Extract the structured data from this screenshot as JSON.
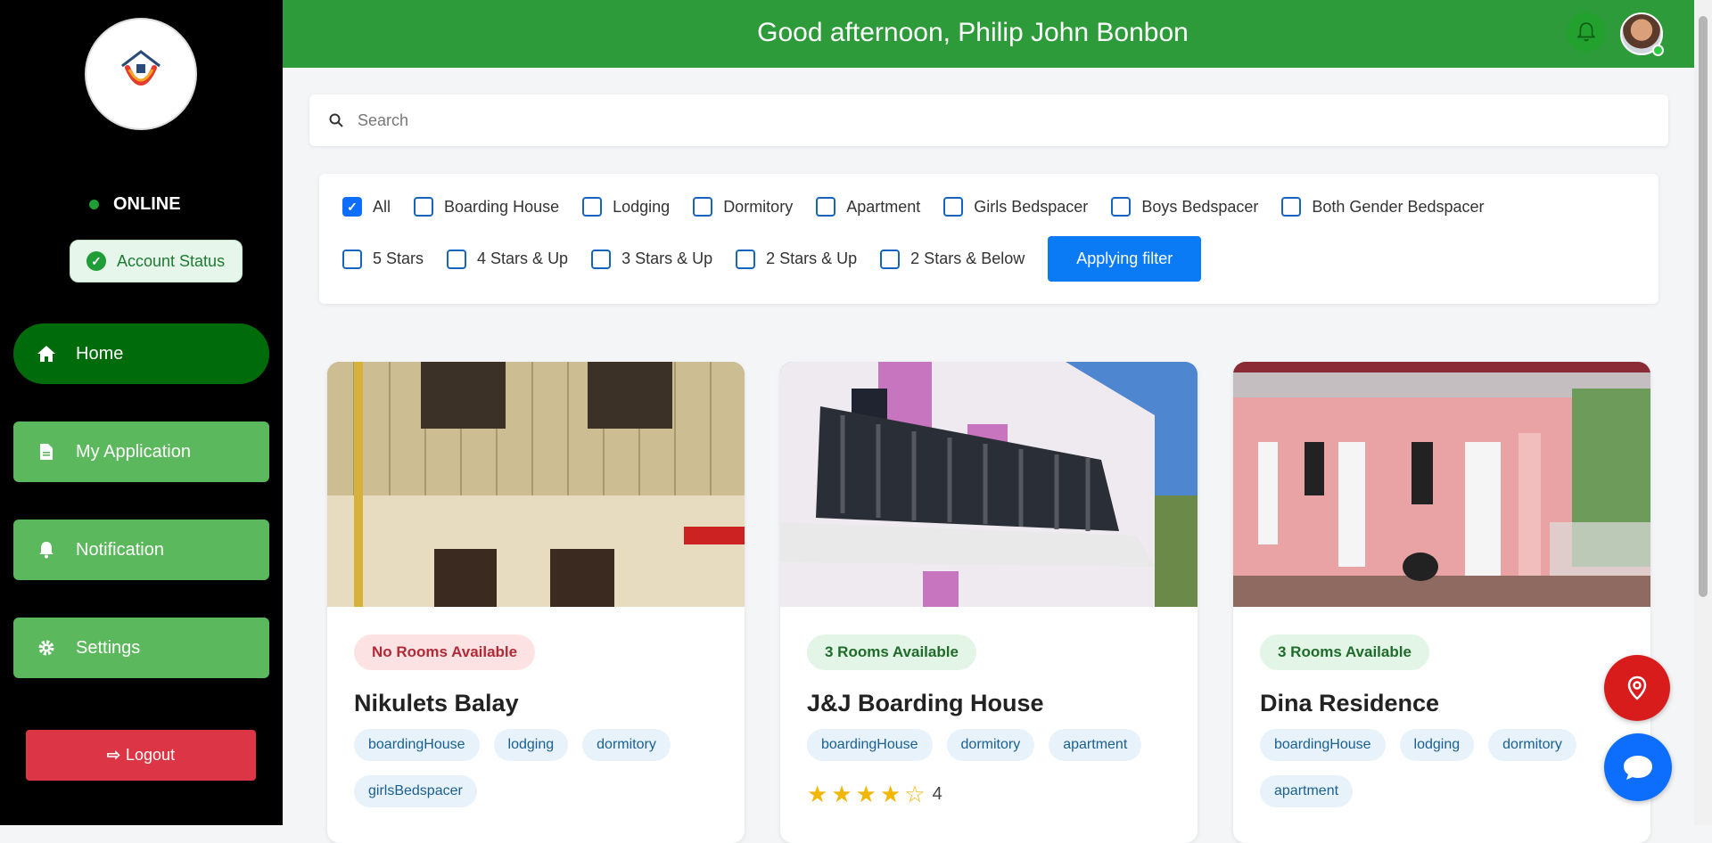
{
  "topbar": {
    "greeting": "Good afternoon, Philip John Bonbon"
  },
  "sidebar": {
    "status": "ONLINE",
    "account_status": "Account Status",
    "items": [
      {
        "label": "Home",
        "icon": "home-icon",
        "active": true
      },
      {
        "label": "My Application",
        "icon": "document-icon"
      },
      {
        "label": "Notification",
        "icon": "bell-icon"
      },
      {
        "label": "Settings",
        "icon": "gear-icon"
      }
    ],
    "logout": "Logout"
  },
  "search": {
    "placeholder": "Search"
  },
  "filters": {
    "types": [
      {
        "label": "All",
        "checked": true
      },
      {
        "label": "Boarding House",
        "checked": false
      },
      {
        "label": "Lodging",
        "checked": false
      },
      {
        "label": "Dormitory",
        "checked": false
      },
      {
        "label": "Apartment",
        "checked": false
      },
      {
        "label": "Girls Bedspacer",
        "checked": false
      },
      {
        "label": "Boys Bedspacer",
        "checked": false
      },
      {
        "label": "Both Gender Bedspacer",
        "checked": false
      }
    ],
    "ratings": [
      {
        "label": "5 Stars",
        "checked": false
      },
      {
        "label": "4 Stars & Up",
        "checked": false
      },
      {
        "label": "3 Stars & Up",
        "checked": false
      },
      {
        "label": "2 Stars & Up",
        "checked": false
      },
      {
        "label": "2 Stars & Below",
        "checked": false
      }
    ],
    "apply_label": "Applying filter"
  },
  "cards": [
    {
      "availability": "No Rooms Available",
      "name": "Nikulets Balay",
      "tags": [
        "boardingHouse",
        "lodging",
        "dormitory",
        "girlsBedspacer"
      ]
    },
    {
      "availability": "3 Rooms Available",
      "name": "J&J Boarding House",
      "tags": [
        "boardingHouse",
        "dormitory",
        "apartment"
      ],
      "rating": "4"
    },
    {
      "availability": "3 Rooms Available",
      "name": "Dina Residence",
      "tags": [
        "boardingHouse",
        "lodging",
        "dormitory",
        "apartment"
      ]
    }
  ],
  "colors": {
    "brand_green": "#2e9b3a",
    "nav_green": "#5cb85c",
    "active_green": "#006b0b",
    "logout_red": "#dc3545",
    "accent_blue": "#0a7bf5"
  }
}
